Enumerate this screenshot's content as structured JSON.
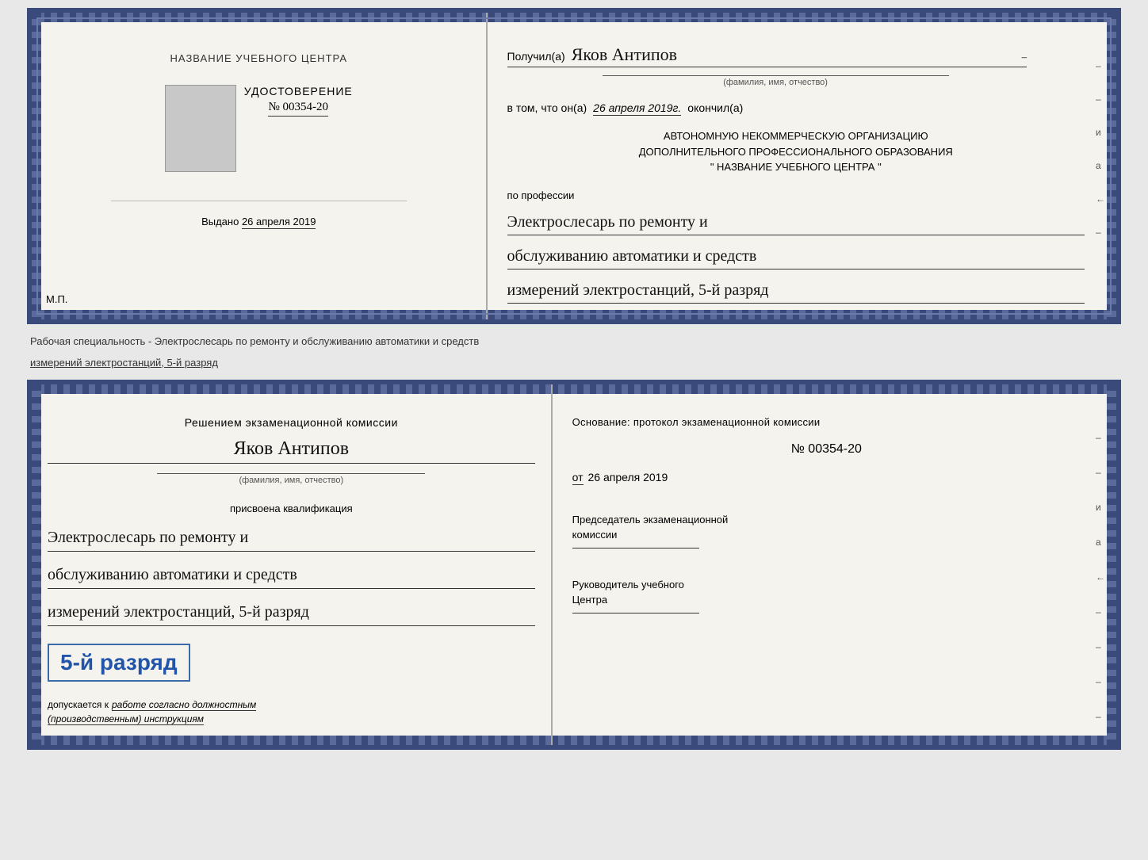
{
  "top_left": {
    "school_name": "НАЗВАНИЕ УЧЕБНОГО ЦЕНТРА",
    "udost_title": "УДОСТОВЕРЕНИЕ",
    "udost_number": "№ 00354-20",
    "issued_label": "Выдано",
    "issued_date": "26 апреля 2019",
    "mp": "М.П."
  },
  "top_right": {
    "received_prefix": "Получил(а)",
    "received_name": "Яков Антипов",
    "fio_label": "(фамилия, имя, отчество)",
    "fact_prefix": "в том, что он(а)",
    "fact_date": "26 апреля 2019г.",
    "fact_suffix": "окончил(а)",
    "org_line1": "АВТОНОМНУЮ НЕКОММЕРЧЕСКУЮ ОРГАНИЗАЦИЮ",
    "org_line2": "ДОПОЛНИТЕЛЬНОГО ПРОФЕССИОНАЛЬНОГО ОБРАЗОВАНИЯ",
    "org_line3": "\"   НАЗВАНИЕ УЧЕБНОГО ЦЕНТРА   \"",
    "profession_label": "по профессии",
    "profession_line1": "Электрослесарь по ремонту и",
    "profession_line2": "обслуживанию автоматики и средств",
    "profession_line3": "измерений электростанций, 5-й разряд"
  },
  "middle": {
    "text": "Рабочая специальность - Электрослесарь по ремонту и обслуживанию автоматики и средств",
    "text2": "измерений электростанций, 5-й разряд"
  },
  "bottom_left": {
    "commission_title": "Решением экзаменационной комиссии",
    "name": "Яков Антипов",
    "fio_label": "(фамилия, имя, отчество)",
    "qualification_label": "присвоена квалификация",
    "qual_line1": "Электрослесарь по ремонту и",
    "qual_line2": "обслуживанию автоматики и средств",
    "qual_line3": "измерений электростанций, 5-й разряд",
    "grade_badge": "5-й разряд",
    "допускается": "допускается к",
    "допускается_italic": "работе согласно должностным",
    "допускается_italic2": "(производственным) инструкциям"
  },
  "bottom_right": {
    "osnov_label": "Основание: протокол экзаменационной комиссии",
    "protocol_number": "№  00354-20",
    "from_label": "от",
    "from_date": "26 апреля 2019",
    "chairman_title": "Председатель экзаменационной",
    "chairman_title2": "комиссии",
    "director_title": "Руководитель учебного",
    "director_title2": "Центра"
  },
  "right_margin": {
    "labels": [
      "–",
      "–",
      "и",
      "а",
      "←",
      "–",
      "–",
      "–",
      "–"
    ]
  }
}
